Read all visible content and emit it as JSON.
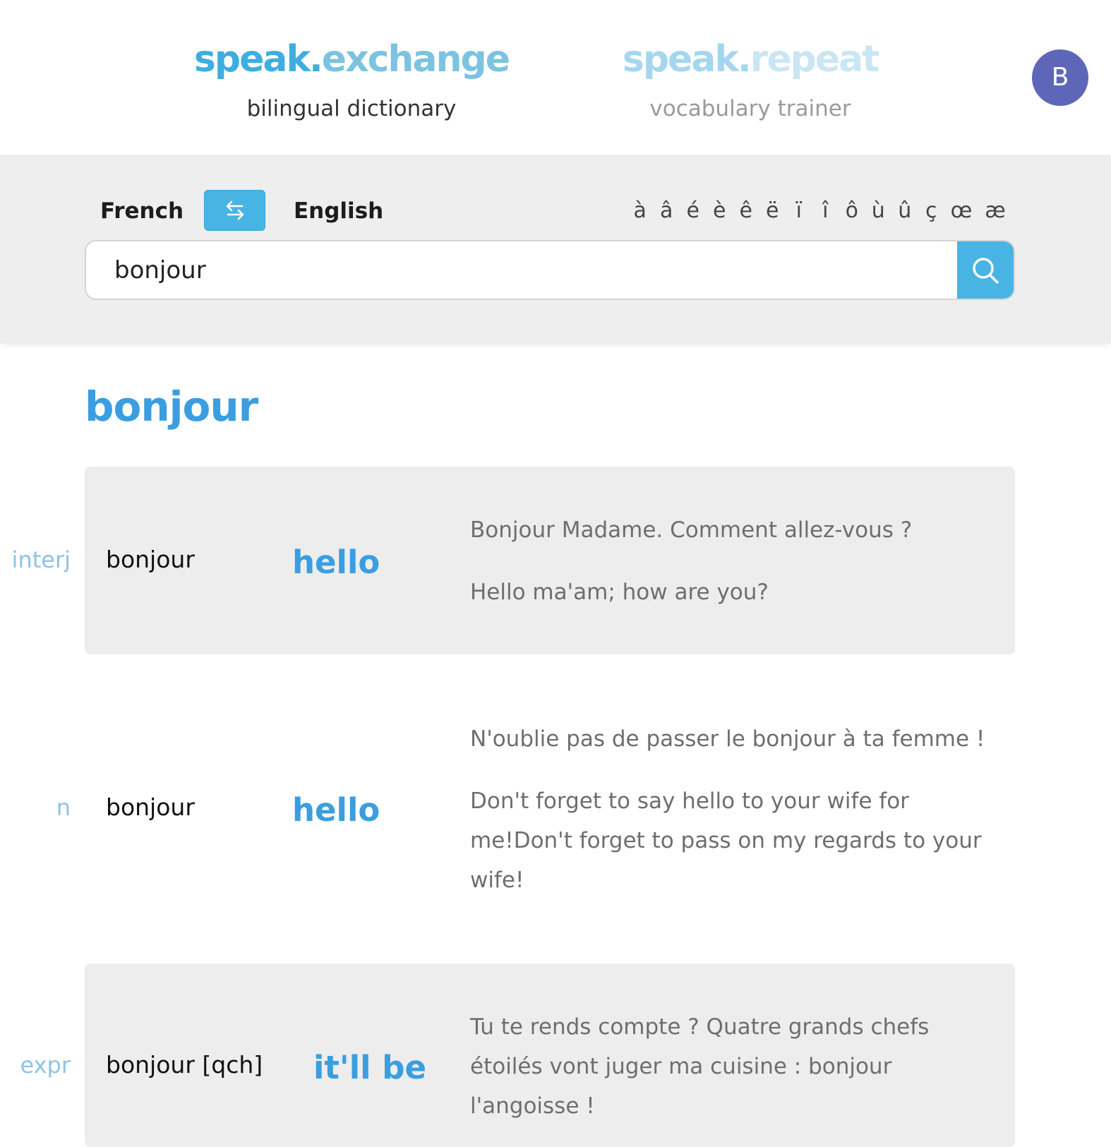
{
  "header": {
    "exchange": {
      "logo_a": "speak.",
      "logo_b": "exchange",
      "subtitle": "bilingual dictionary"
    },
    "repeat": {
      "logo_a": "speak.",
      "logo_b": "repeat",
      "subtitle": "vocabulary trainer"
    },
    "avatar_initial": "B"
  },
  "search": {
    "from_lang": "French",
    "to_lang": "English",
    "swap_icon": "swap-arrows-icon",
    "accents": [
      "à",
      "â",
      "é",
      "è",
      "ê",
      "ë",
      "ï",
      "î",
      "ô",
      "ù",
      "û",
      "ç",
      "œ",
      "æ"
    ],
    "query": "bonjour",
    "search_icon": "magnifier-icon"
  },
  "results": {
    "headword": "bonjour",
    "entries": [
      {
        "pos": "interj",
        "term": "bonjour",
        "translation": "hello",
        "examples": [
          "Bonjour Madame. Comment allez-vous ?",
          "Hello ma'am; how are you?"
        ]
      },
      {
        "pos": "n",
        "term": "bonjour",
        "translation": "hello",
        "examples": [
          "N'oublie pas de passer le bonjour à ta femme !",
          "Don't forget to say hello to your wife for me!Don't forget to pass on my regards to your wife!"
        ]
      },
      {
        "pos": "expr",
        "term": "bonjour [qch]",
        "translation": "it'll be",
        "examples": [
          "Tu te rends compte ? Quatre grands chefs étoilés vont juger ma cuisine : bonjour l'angoisse !"
        ]
      }
    ]
  },
  "colors": {
    "accent": "#48b4e4",
    "headword": "#3a9ee0",
    "avatar": "#5e67b7"
  }
}
